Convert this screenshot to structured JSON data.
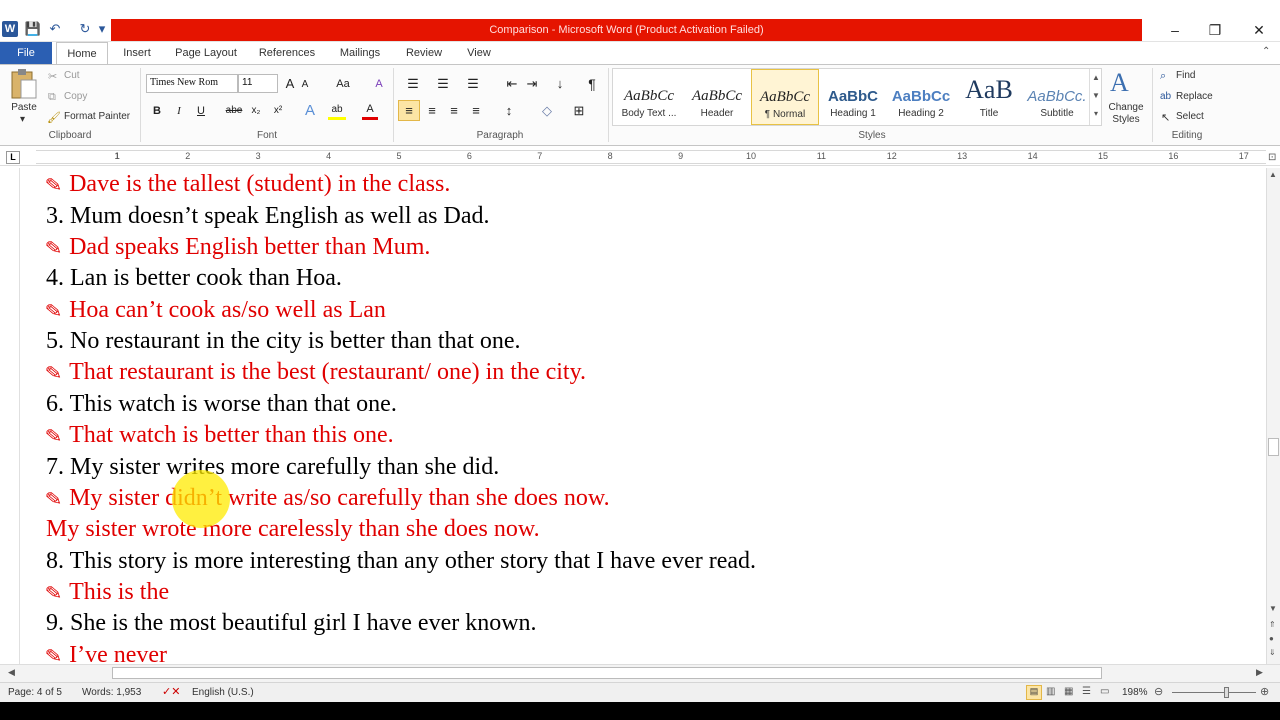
{
  "window": {
    "title": "Comparison - Microsoft Word (Product Activation Failed)",
    "app_icon": "W",
    "minimize": "–",
    "restore": "❐",
    "close": "✕"
  },
  "quick_access": {
    "save": "💾",
    "undo": "↶",
    "redo": "↻",
    "more": "▾"
  },
  "tabs": [
    {
      "label": "File"
    },
    {
      "label": "Home"
    },
    {
      "label": "Insert"
    },
    {
      "label": "Page Layout"
    },
    {
      "label": "References"
    },
    {
      "label": "Mailings"
    },
    {
      "label": "Review"
    },
    {
      "label": "View"
    }
  ],
  "clipboard": {
    "paste": "Paste",
    "cut": "Cut",
    "copy": "Copy",
    "format_painter": "Format Painter",
    "group": "Clipboard"
  },
  "font": {
    "name": "Times New Rom",
    "size": "11",
    "bold": "B",
    "italic": "I",
    "underline": "U",
    "strike": "abe",
    "sub": "x₂",
    "sup": "x²",
    "group": "Font",
    "grow": "A",
    "shrink": "A",
    "case": "Aa",
    "clear": "A",
    "effects": "A",
    "highlight": "ab",
    "color": "A"
  },
  "paragraph": {
    "group": "Paragraph",
    "pilcrow": "¶",
    "sort": "↓"
  },
  "styles": {
    "group": "Styles",
    "items": [
      {
        "preview": "AaBbCc",
        "name": "Body Text ..."
      },
      {
        "preview": "AaBbCc",
        "name": "Header"
      },
      {
        "preview": "AaBbCc",
        "name": "¶ Normal"
      },
      {
        "preview": "AaBbC",
        "name": "Heading 1"
      },
      {
        "preview": "AaBbCc",
        "name": "Heading 2"
      },
      {
        "preview": "AaB",
        "name": "Title"
      },
      {
        "preview": "AaBbCc.",
        "name": "Subtitle"
      }
    ],
    "change_styles": "Change Styles"
  },
  "editing": {
    "find": "Find",
    "replace": "Replace",
    "select": "Select",
    "group": "Editing"
  },
  "ruler_numbers": [
    "1",
    "1",
    "2",
    "3",
    "4",
    "5",
    "6",
    "7",
    "8",
    "9",
    "10",
    "11",
    "12",
    "13",
    "14",
    "15",
    "16",
    "17"
  ],
  "document": {
    "lines": [
      {
        "color": "red",
        "arrow": true,
        "text": "Dave is the tallest (student) in the class."
      },
      {
        "color": "black",
        "arrow": false,
        "text": "3. Mum doesn’t speak English as well as Dad."
      },
      {
        "color": "red",
        "arrow": true,
        "text": "Dad speaks English better than Mum."
      },
      {
        "color": "black",
        "arrow": false,
        "text": "4. Lan is better cook than Hoa."
      },
      {
        "color": "red",
        "arrow": true,
        "text": "Hoa can’t cook as/so well as Lan"
      },
      {
        "color": "black",
        "arrow": false,
        "text": "5. No restaurant in the city is better than that one."
      },
      {
        "color": "red",
        "arrow": true,
        "text": "That restaurant is the best (restaurant/ one) in the city."
      },
      {
        "color": "black",
        "arrow": false,
        "text": "6. This watch is worse than that one."
      },
      {
        "color": "red",
        "arrow": true,
        "text": "That watch is better than this one."
      },
      {
        "color": "black",
        "arrow": false,
        "text": "7. My sister writes more carefully than she did."
      },
      {
        "color": "red",
        "arrow": true,
        "text": "My sister didn’t write as/so carefully than she does now."
      },
      {
        "color": "red",
        "arrow": false,
        "text": "My sister wrote more carelessly than she does now."
      },
      {
        "color": "black",
        "arrow": false,
        "text": "8. This story is more interesting than any other story that I have ever read."
      },
      {
        "color": "red",
        "arrow": true,
        "text": "This is the"
      },
      {
        "color": "black",
        "arrow": false,
        "text": "9. She is the most beautiful girl I have ever known."
      },
      {
        "color": "red",
        "arrow": true,
        "text": "I’ve never"
      }
    ]
  },
  "status": {
    "page": "Page: 4 of 5",
    "words": "Words: 1,953",
    "language": "English (U.S.)",
    "zoom": "198%"
  }
}
